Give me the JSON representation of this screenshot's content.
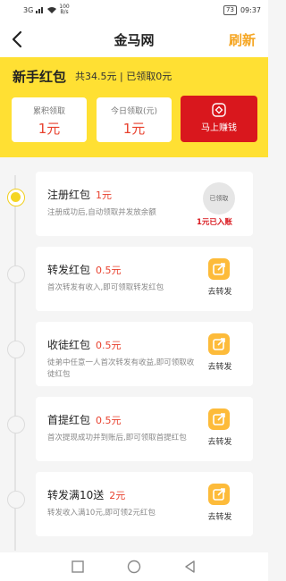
{
  "status_bar": {
    "signal": "3G",
    "network_speed_value": "100",
    "network_speed_unit": "B/s",
    "battery": "73",
    "time": "09:37"
  },
  "header": {
    "title": "金马网",
    "refresh_label": "刷新"
  },
  "banner": {
    "title": "新手红包",
    "summary": "共34.5元 | 已领取0元",
    "stats": [
      {
        "label": "累积领取",
        "value": "1元"
      },
      {
        "label": "今日领取(元)",
        "value": "1元"
      }
    ],
    "earn_button_label": "马上赚钱"
  },
  "tasks": [
    {
      "title": "注册红包",
      "amount": "1元",
      "desc": "注册成功后,自动领取并发放余额",
      "badge": "已领取",
      "status": "1元已入账"
    },
    {
      "title": "转发红包",
      "amount": "0.5元",
      "desc": "首次转发有收入,即可领取转发红包",
      "action": "去转发"
    },
    {
      "title": "收徒红包",
      "amount": "0.5元",
      "desc": "徒弟中任意一人首次转发有收益,即可领取收徒红包",
      "action": "去转发"
    },
    {
      "title": "首提红包",
      "amount": "0.5元",
      "desc": "首次提现成功并到账后,即可领取首提红包",
      "action": "去转发"
    },
    {
      "title": "转发满10送",
      "amount": "2元",
      "desc": "转发收入满10元,即可领2元红包",
      "action": "去转发"
    }
  ],
  "icons": {
    "back": "back-arrow-icon",
    "earn": "diamond-icon",
    "share": "share-icon",
    "nav_recent": "square-icon",
    "nav_home": "circle-icon",
    "nav_back": "triangle-icon"
  },
  "colors": {
    "accent_yellow": "#ffe033",
    "brand_red": "#d9171d",
    "amount_red": "#e8412e",
    "refresh_orange": "#f5a623",
    "share_orange": "#fdbb3a"
  }
}
